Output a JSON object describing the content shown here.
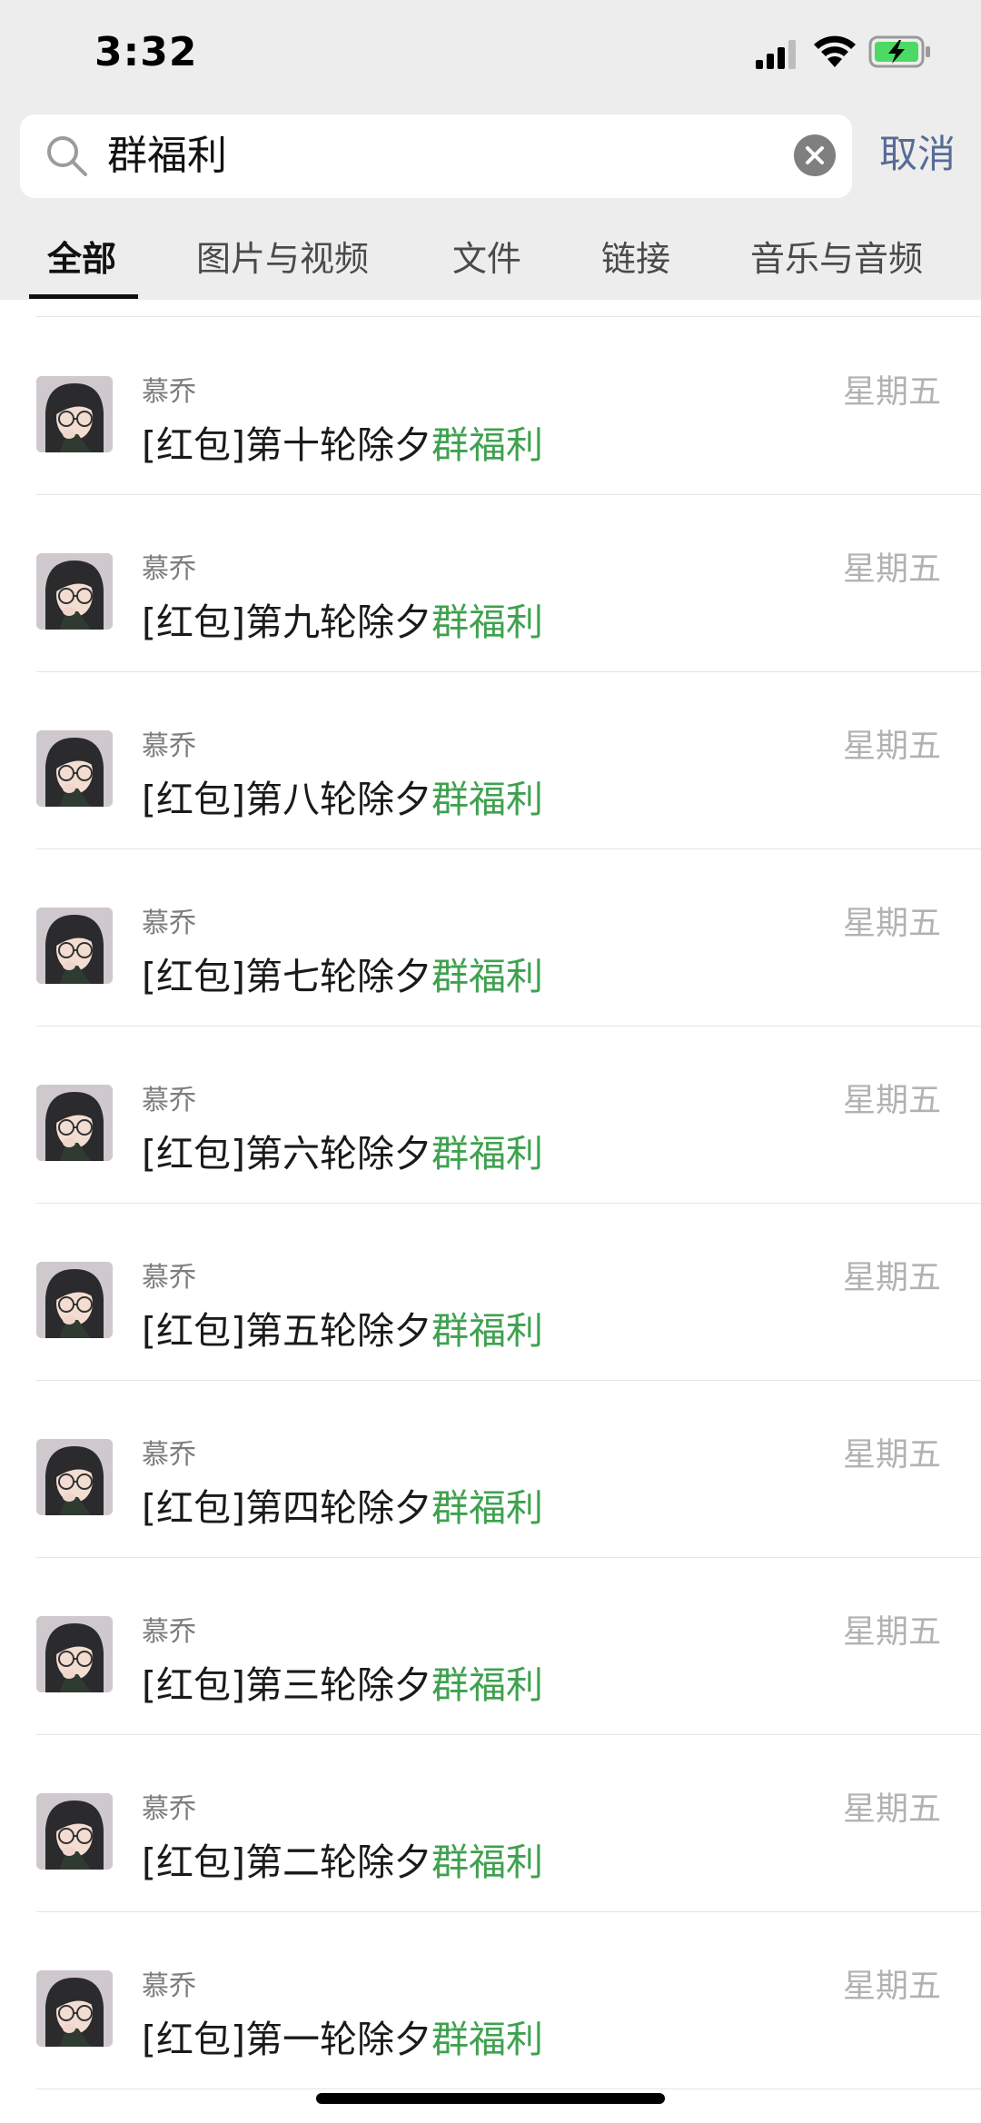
{
  "status_bar": {
    "time": "3:32"
  },
  "search": {
    "query": "群福利",
    "cancel_label": "取消"
  },
  "tabs": [
    {
      "label": "全部",
      "active": true
    },
    {
      "label": "图片与视频",
      "active": false
    },
    {
      "label": "文件",
      "active": false
    },
    {
      "label": "链接",
      "active": false
    },
    {
      "label": "音乐与音频",
      "active": false
    }
  ],
  "results": [
    {
      "sender": "慕乔",
      "prefix": "[红包]第十轮除夕",
      "highlight": "群福利",
      "date": "星期五"
    },
    {
      "sender": "慕乔",
      "prefix": "[红包]第九轮除夕",
      "highlight": "群福利",
      "date": "星期五"
    },
    {
      "sender": "慕乔",
      "prefix": "[红包]第八轮除夕",
      "highlight": "群福利",
      "date": "星期五"
    },
    {
      "sender": "慕乔",
      "prefix": "[红包]第七轮除夕",
      "highlight": "群福利",
      "date": "星期五"
    },
    {
      "sender": "慕乔",
      "prefix": "[红包]第六轮除夕",
      "highlight": "群福利",
      "date": "星期五"
    },
    {
      "sender": "慕乔",
      "prefix": "[红包]第五轮除夕",
      "highlight": "群福利",
      "date": "星期五"
    },
    {
      "sender": "慕乔",
      "prefix": "[红包]第四轮除夕",
      "highlight": "群福利",
      "date": "星期五"
    },
    {
      "sender": "慕乔",
      "prefix": "[红包]第三轮除夕",
      "highlight": "群福利",
      "date": "星期五"
    },
    {
      "sender": "慕乔",
      "prefix": "[红包]第二轮除夕",
      "highlight": "群福利",
      "date": "星期五"
    },
    {
      "sender": "慕乔",
      "prefix": "[红包]第一轮除夕",
      "highlight": "群福利",
      "date": "星期五"
    }
  ],
  "colors": {
    "highlight": "#3fa14f",
    "cancel": "#576b95",
    "header_bg": "#ededed",
    "battery_fill": "#4cd964"
  },
  "icons": {
    "search": "search-icon",
    "clear": "clear-icon",
    "signal": "signal-icon",
    "wifi": "wifi-icon",
    "battery": "battery-charging-icon"
  }
}
